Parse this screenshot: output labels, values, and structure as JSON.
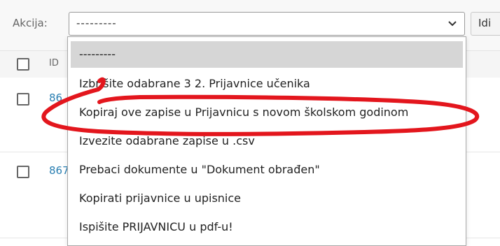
{
  "action_bar": {
    "label": "Akcija:",
    "selected_value": "---------",
    "go_label": "Idi"
  },
  "table": {
    "header_id": "ID",
    "rows": [
      {
        "id": "86"
      },
      {
        "id": "867"
      }
    ]
  },
  "dropdown": {
    "options": [
      "---------",
      "Izbrišite odabrane 3 2. Prijavnice učenika",
      "Kopiraj ove zapise u Prijavnicu s novom školskom godinom",
      "Izvezite odabrane zapise u .csv",
      "Prebaci dokumente u \"Dokument obrađen\"",
      "Kopirati prijavnice u upisnice",
      "Ispišite PRIJAVNICU u pdf-u!"
    ]
  },
  "colors": {
    "annotation": "#e3161d",
    "link": "#2a7fb2",
    "selected_option": "#d6d6d6"
  }
}
